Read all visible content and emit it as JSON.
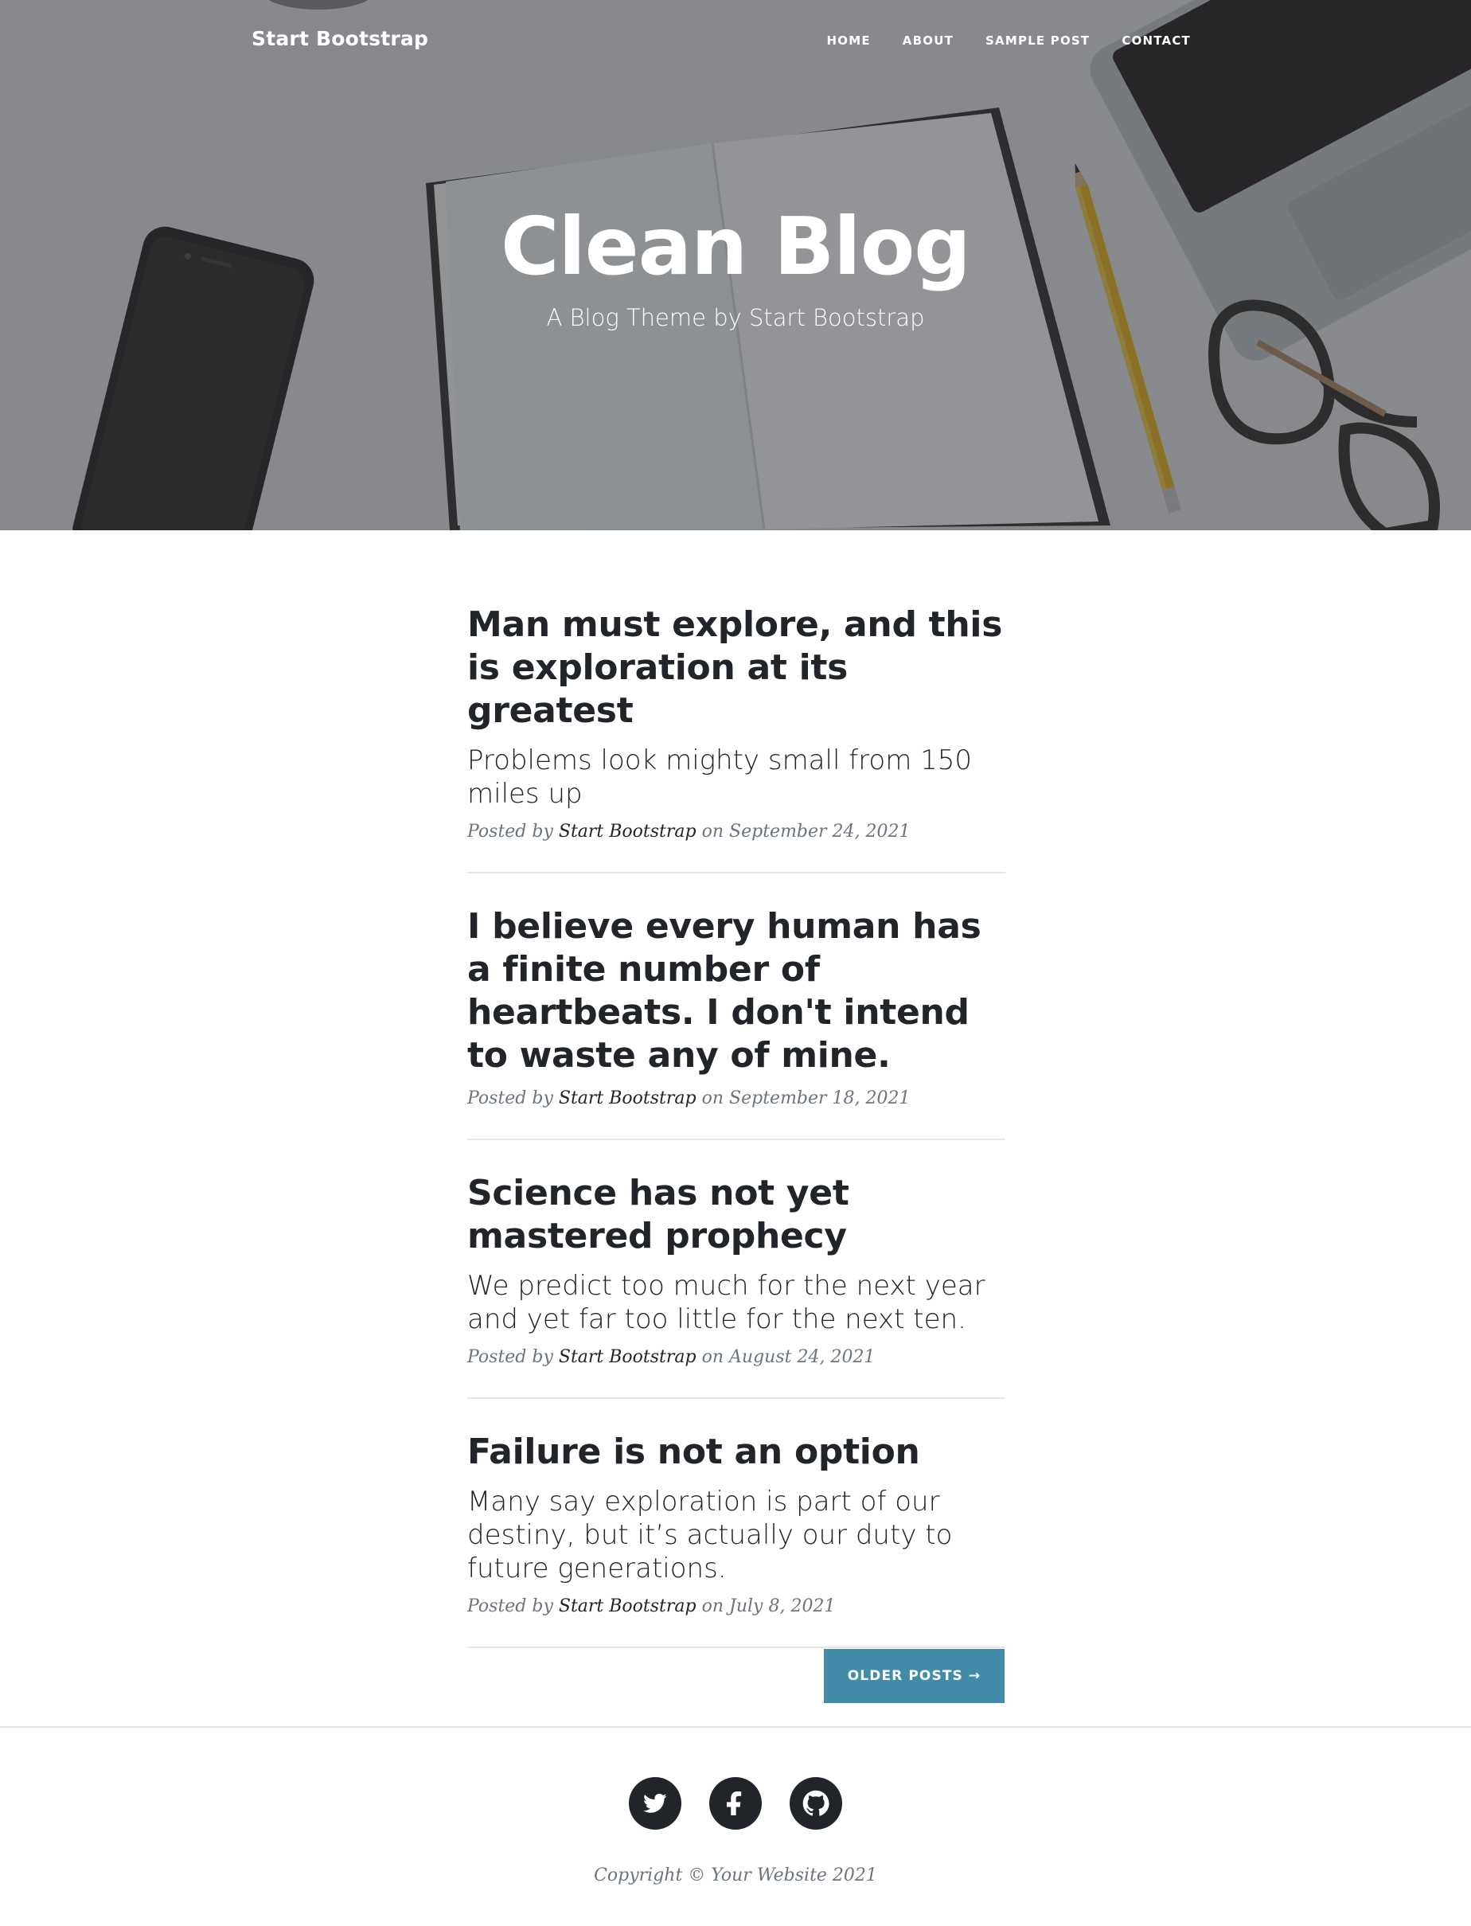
{
  "nav": {
    "brand": "Start Bootstrap",
    "links": [
      "HOME",
      "ABOUT",
      "SAMPLE POST",
      "CONTACT"
    ]
  },
  "hero": {
    "title": "Clean Blog",
    "subtitle": "A Blog Theme by Start Bootstrap"
  },
  "posts": [
    {
      "title": "Man must explore, and this is exploration at its greatest",
      "subtitle": "Problems look mighty small from 150 miles up",
      "meta_prefix": "Posted by ",
      "author": "Start Bootstrap",
      "meta_on": " on ",
      "date": "September 24, 2021"
    },
    {
      "title": "I believe every human has a finite number of heartbeats. I don't intend to waste any of mine.",
      "subtitle": "",
      "meta_prefix": "Posted by ",
      "author": "Start Bootstrap",
      "meta_on": " on ",
      "date": "September 18, 2021"
    },
    {
      "title": "Science has not yet mastered prophecy",
      "subtitle": "We predict too much for the next year and yet far too little for the next ten.",
      "meta_prefix": "Posted by ",
      "author": "Start Bootstrap",
      "meta_on": " on ",
      "date": "August 24, 2021"
    },
    {
      "title": "Failure is not an option",
      "subtitle": "Many say exploration is part of our destiny, but it’s actually our duty to future generations.",
      "meta_prefix": "Posted by ",
      "author": "Start Bootstrap",
      "meta_on": " on ",
      "date": "July 8, 2021"
    }
  ],
  "pager": {
    "label": "OLDER POSTS →"
  },
  "footer": {
    "social": [
      "twitter-icon",
      "facebook-icon",
      "github-icon"
    ],
    "copyright": "Copyright © Your Website 2021"
  },
  "colors": {
    "accent": "#428ba9",
    "text": "#212529",
    "muted": "#6c757d"
  }
}
